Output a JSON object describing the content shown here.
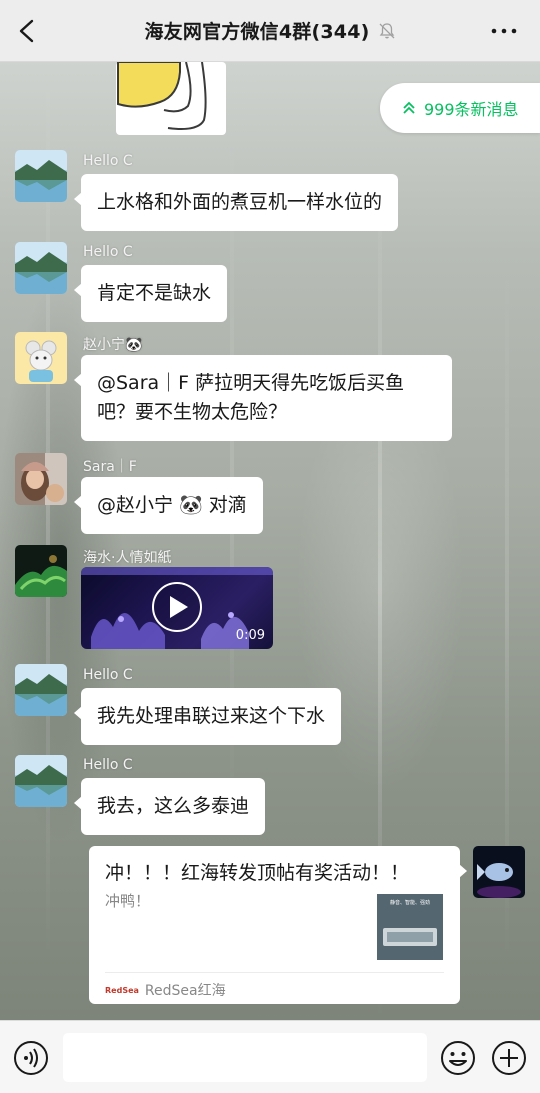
{
  "header": {
    "title": "海友网官方微信4群(344)",
    "back_icon": "chevron-left-icon",
    "mute_icon": "bell-mute-icon",
    "more_icon": "more-dots-icon"
  },
  "new_messages": {
    "label": "999条新消息",
    "icon": "double-chevron-up-icon",
    "color": "#07c160"
  },
  "messages": [
    {
      "sender": "Hello C",
      "text": "上水格和外面的煮豆机一样水位的"
    },
    {
      "sender": "Hello C",
      "text": "肯定不是缺水"
    },
    {
      "sender": "赵小宁🐼",
      "text_line1": "@Sara｜F  萨拉明天得先吃饭后买鱼",
      "text_line2": "吧？要不生物太危险？"
    },
    {
      "sender": "Sara｜F",
      "text": "@赵小宁 🐼  对滴"
    },
    {
      "sender": "海水·人情如紙",
      "video_duration": "0:09"
    },
    {
      "sender": "Hello C",
      "text": "我先处理串联过来这个下水"
    },
    {
      "sender": "Hello C",
      "text": "我去，这么多泰迪"
    }
  ],
  "link_card": {
    "title": "冲！！！红海转发顶帖有奖活动！！",
    "desc": "冲鸭！",
    "source": "RedSea红海",
    "source_logo": "RedSea",
    "thumb_caption": "静音、智能、强劲"
  },
  "bottom_bar": {
    "voice_icon": "voice-icon",
    "input_value": "",
    "emoji_icon": "emoji-icon",
    "plus_icon": "plus-circle-icon"
  }
}
